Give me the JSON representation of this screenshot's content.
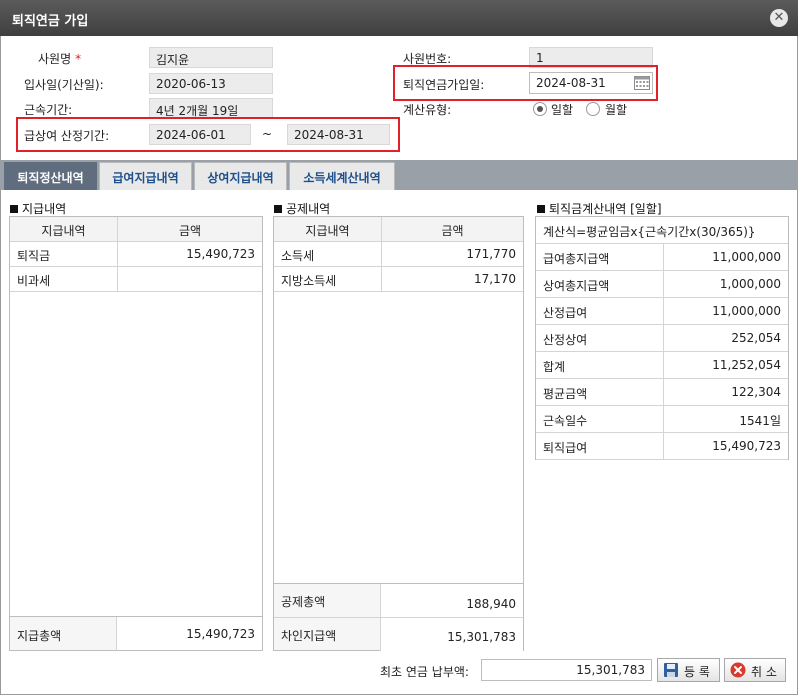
{
  "window": {
    "title": "퇴직연금 가입"
  },
  "form": {
    "employee_name_label": "사원명",
    "required_mark": "*",
    "employee_name": "김지윤",
    "employee_no_label": "사원번호:",
    "employee_no": "1",
    "hire_date_label": "입사일(기산일):",
    "hire_date": "2020-06-13",
    "pension_join_date_label": "퇴직연금가입일:",
    "pension_join_date": "2024-08-31",
    "service_period_label": "근속기간:",
    "service_period": "4년 2개월 19일",
    "calc_type_label": "계산유형:",
    "calc_type_options": [
      "일할",
      "월할"
    ],
    "calc_type_selected": "일할",
    "pay_period_label": "급상여 산정기간:",
    "pay_period_from": "2024-06-01",
    "pay_period_tilde": "~",
    "pay_period_to": "2024-08-31"
  },
  "tabs": [
    {
      "label": "퇴직정산내역",
      "active": true
    },
    {
      "label": "급여지급내역",
      "active": false
    },
    {
      "label": "상여지급내역",
      "active": false
    },
    {
      "label": "소득세계산내역",
      "active": false
    }
  ],
  "payments": {
    "title": "지급내역",
    "col_item": "지급내역",
    "col_amount": "금액",
    "rows": [
      {
        "item": "퇴직금",
        "amount": "15,490,723"
      },
      {
        "item": "비과세",
        "amount": ""
      }
    ],
    "total_label": "지급총액",
    "total_value": "15,490,723"
  },
  "deductions": {
    "title": "공제내역",
    "col_item": "지급내역",
    "col_amount": "금액",
    "rows": [
      {
        "item": "소득세",
        "amount": "171,770"
      },
      {
        "item": "지방소득세",
        "amount": "17,170"
      }
    ],
    "total_label": "공제총액",
    "total_value": "188,940",
    "net_label": "차인지급액",
    "net_value": "15,301,783"
  },
  "calc": {
    "title": "퇴직금계산내역 [일할]",
    "formula": "계산식=평균임금x{근속기간x(30/365)}",
    "rows": [
      {
        "label": "급여총지급액",
        "value": "11,000,000"
      },
      {
        "label": "상여총지급액",
        "value": "1,000,000"
      },
      {
        "label": "산정급여",
        "value": "11,000,000"
      },
      {
        "label": "산정상여",
        "value": "252,054"
      },
      {
        "label": "합계",
        "value": "11,252,054"
      },
      {
        "label": "평균금액",
        "value": "122,304"
      },
      {
        "label": "근속일수",
        "value": "1541일"
      },
      {
        "label": "퇴직급여",
        "value": "15,490,723"
      }
    ]
  },
  "footer": {
    "initial_payment_label": "최초 연금 납부액:",
    "initial_payment_value": "15,301,783",
    "register_label": "등 록",
    "cancel_label": "취 소"
  },
  "colors": {
    "highlight_border": "#e0202a",
    "active_tab": "#5f6d7e",
    "tab_text": "#1d4f8a"
  }
}
